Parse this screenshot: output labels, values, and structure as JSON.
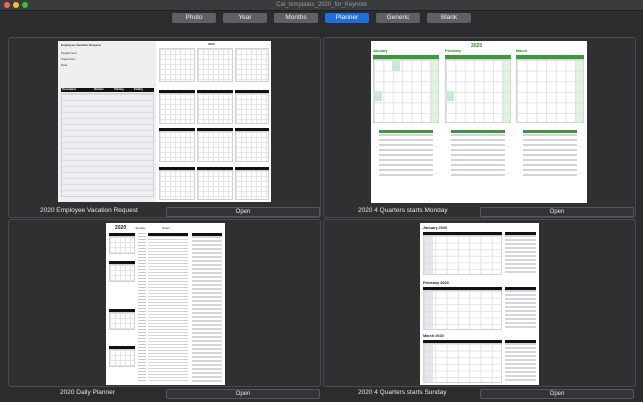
{
  "window": {
    "title": "Cal_templates_2020_for_Keynote"
  },
  "tabs": [
    {
      "label": "Photo"
    },
    {
      "label": "Year"
    },
    {
      "label": "Months"
    },
    {
      "label": "Planner"
    },
    {
      "label": "Generic"
    },
    {
      "label": "Blank"
    }
  ],
  "active_tab": "Planner",
  "colors": {
    "accent": "#1f6fe3",
    "panel": "#2f3032",
    "background": "#2b2c2e",
    "green": "#3a9a3a"
  },
  "templates": [
    {
      "caption": "2020 Employee Vacation Request",
      "open_label": "Open",
      "thumb": {
        "heading": "Employee Vacation Request",
        "year": "2020",
        "fields": [
          "Department",
          "Supervisor",
          "Date"
        ],
        "columns": [
          "Description",
          "Number",
          "Starting",
          "Ending"
        ],
        "months": [
          "January",
          "February",
          "March",
          "April",
          "May",
          "June",
          "July",
          "August",
          "September",
          "October",
          "November",
          "December"
        ]
      }
    },
    {
      "caption": "2020 4 Quarters starts Monday",
      "open_label": "Open",
      "thumb": {
        "year": "2020",
        "months": [
          "January",
          "February",
          "March"
        ]
      }
    },
    {
      "caption": "2020 Daily Planner",
      "open_label": "Open",
      "thumb": {
        "year": "2020",
        "labels": [
          "January",
          "Notes"
        ]
      }
    },
    {
      "caption": "2020 4 Quarters starts Sunday",
      "open_label": "Open",
      "thumb": {
        "months": [
          "January 2020",
          "February 2020",
          "March 2020"
        ]
      }
    }
  ]
}
